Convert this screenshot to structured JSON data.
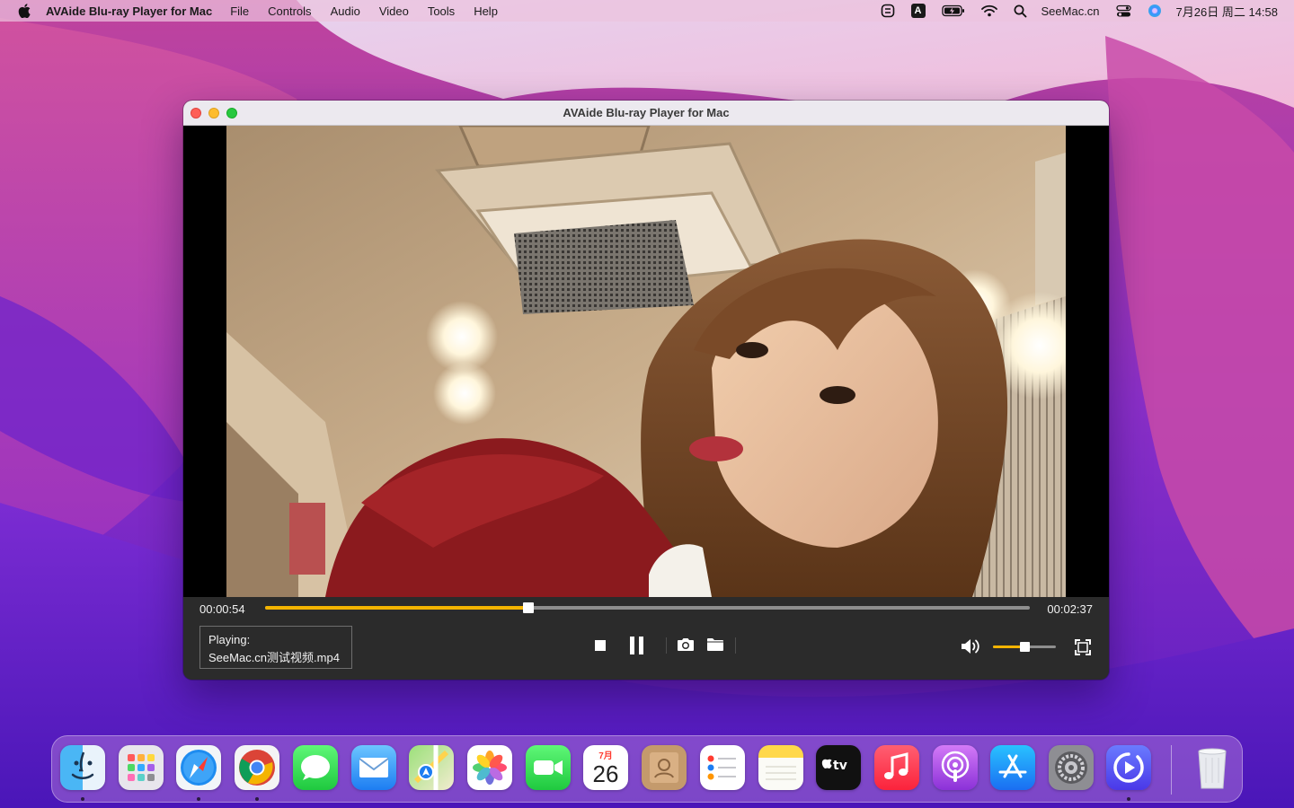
{
  "menubar": {
    "app_name": "AVAide Blu-ray Player for Mac",
    "menus": [
      "File",
      "Controls",
      "Audio",
      "Video",
      "Tools",
      "Help"
    ],
    "status_text": "SeeMac.cn",
    "input_badge": "A",
    "clock": "7月26日 周二  14:58"
  },
  "window": {
    "title": "AVAide Blu-ray Player for Mac"
  },
  "player": {
    "time_current": "00:00:54",
    "time_total": "00:02:37",
    "progress": 0.344,
    "volume": 0.5,
    "now_playing_label": "Playing:",
    "now_playing_file": "SeeMac.cn测试视频.mp4",
    "accent_color": "#f4b400"
  },
  "dock": {
    "calendar_month": "7月",
    "calendar_day": "26",
    "icons": [
      "finder-icon",
      "launchpad-icon",
      "safari-icon",
      "chrome-icon",
      "messages-icon",
      "mail-icon",
      "maps-icon",
      "photos-icon",
      "facetime-icon",
      "calendar-icon",
      "contacts-icon",
      "reminders-icon",
      "notes-icon",
      "apple-tv-icon",
      "music-icon",
      "podcasts-icon",
      "app-store-icon",
      "system-preferences-icon",
      "avaide-player-icon",
      "trash-icon"
    ]
  }
}
